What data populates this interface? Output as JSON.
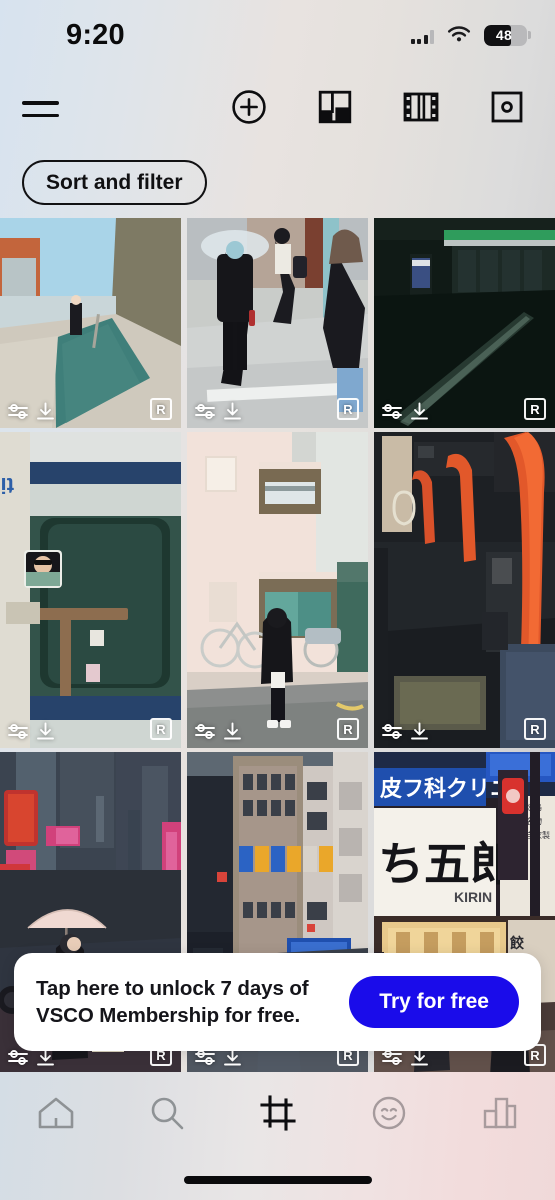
{
  "status_bar": {
    "time": "9:20",
    "battery_level": "48",
    "cellular_icon": "cellular-signal-icon",
    "wifi_icon": "wifi-icon",
    "battery_icon": "battery-icon"
  },
  "toolbar": {
    "menu_icon": "hamburger-menu-icon",
    "actions": [
      {
        "name": "new-button",
        "icon": "plus-circle-icon"
      },
      {
        "name": "collage-button",
        "icon": "collage-icon"
      },
      {
        "name": "montage-button",
        "icon": "film-strip-icon"
      },
      {
        "name": "camera-button",
        "icon": "camera-icon"
      }
    ]
  },
  "filter": {
    "sort_and_filter_label": "Sort and filter"
  },
  "grid": {
    "items": [
      {
        "alt": "narrow japanese alley with person walking",
        "edit_icon": "edit-sliders-icon",
        "download_icon": "download-icon",
        "badge": "R"
      },
      {
        "alt": "people crossing street with clear umbrella",
        "edit_icon": "edit-sliders-icon",
        "download_icon": "download-icon",
        "badge": "R"
      },
      {
        "alt": "dark train station platform",
        "edit_icon": "edit-sliders-icon",
        "download_icon": "download-icon",
        "badge": "R"
      },
      {
        "alt": "person reflected in train door window",
        "edit_icon": "edit-sliders-icon",
        "download_icon": "download-icon",
        "badge": "R"
      },
      {
        "alt": "person standing before pink apartment building",
        "edit_icon": "edit-sliders-icon",
        "download_icon": "download-icon",
        "badge": "R"
      },
      {
        "alt": "bus interior with orange handrails",
        "edit_icon": "edit-sliders-icon",
        "download_icon": "download-icon",
        "badge": "R"
      },
      {
        "alt": "rainy night street with umbrella and car",
        "edit_icon": "edit-sliders-icon",
        "download_icon": "download-icon",
        "badge": "R"
      },
      {
        "alt": "city intersection at night with signage",
        "edit_icon": "edit-sliders-icon",
        "download_icon": "download-icon",
        "badge": "R"
      },
      {
        "alt": "neon japanese storefront signs at night",
        "edit_icon": "edit-sliders-icon",
        "download_icon": "download-icon",
        "badge": "R"
      }
    ]
  },
  "promo": {
    "line1": "Tap here to unlock 7 days of",
    "line2": "VSCO Membership for free.",
    "button_label": "Try for free",
    "button_color": "#1a0cea"
  },
  "tabbar": {
    "tabs": [
      {
        "name": "tab-home",
        "icon": "home-icon",
        "active": false
      },
      {
        "name": "tab-search",
        "icon": "search-icon",
        "active": false
      },
      {
        "name": "tab-studio",
        "icon": "crop-frame-icon",
        "active": true
      },
      {
        "name": "tab-profile",
        "icon": "smiley-face-icon",
        "active": false
      },
      {
        "name": "tab-insights",
        "icon": "bar-chart-icon",
        "active": false
      }
    ],
    "home_indicator": "home-indicator"
  }
}
